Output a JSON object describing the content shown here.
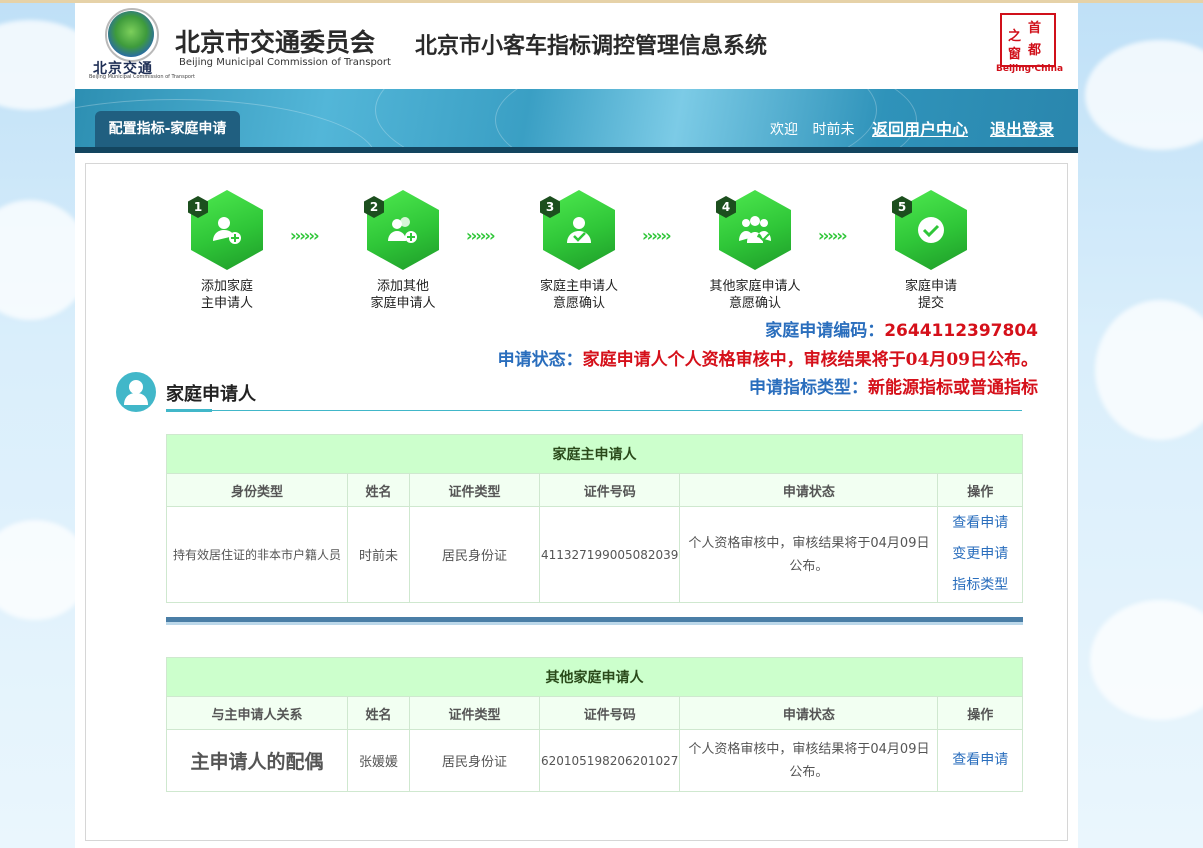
{
  "header": {
    "logo_cn": "北京交通",
    "logo_en": "Beijing Municipal Commission of Transport",
    "org_cn": "北京市交通委员会",
    "org_en": "Beijing Municipal Commission of Transport",
    "system_title": "北京市小客车指标调控管理信息系统",
    "capital_chars": [
      "首",
      "都",
      "之",
      "窗"
    ],
    "capital_en": "Beijing·China"
  },
  "banner": {
    "tab_label": "配置指标-家庭申请",
    "welcome": "欢迎",
    "username": "时前未",
    "back_link": "返回用户中心",
    "logout_link": "退出登录"
  },
  "steps": [
    {
      "num": "1",
      "label1": "添加家庭",
      "label2": "主申请人",
      "icon": "add-user-icon"
    },
    {
      "num": "2",
      "label1": "添加其他",
      "label2": "家庭申请人",
      "icon": "add-group-user-icon"
    },
    {
      "num": "3",
      "label1": "家庭主申请人",
      "label2": "意愿确认",
      "icon": "user-check-icon"
    },
    {
      "num": "4",
      "label1": "其他家庭申请人",
      "label2": "意愿确认",
      "icon": "group-check-icon"
    },
    {
      "num": "5",
      "label1": "家庭申请",
      "label2": "提交",
      "icon": "checkmark-icon"
    }
  ],
  "arrows": "››››››",
  "info": {
    "code_key": "家庭申请编码：",
    "code_val": "2644112397804",
    "status_key": "申请状态：",
    "status_val": "家庭申请人个人资格审核中，审核结果将于04月09日公布。",
    "type_key": "申请指标类型：",
    "type_val": "新能源指标或普通指标"
  },
  "section": {
    "title": "家庭申请人"
  },
  "main_table": {
    "title": "家庭主申请人",
    "headers": [
      "身份类型",
      "姓名",
      "证件类型",
      "证件号码",
      "申请状态",
      "操作"
    ],
    "row": {
      "identity": "持有效居住证的非本市户籍人员",
      "name": "时前未",
      "id_type": "居民身份证",
      "id_number": "411327199005082039",
      "status": "个人资格审核中，审核结果将于04月09日公布。",
      "op1": "查看申请",
      "op2": "变更申请指标类型"
    }
  },
  "other_table": {
    "title": "其他家庭申请人",
    "headers": [
      "与主申请人关系",
      "姓名",
      "证件类型",
      "证件号码",
      "申请状态",
      "操作"
    ],
    "row": {
      "relation": "主申请人的配偶",
      "name": "张媛媛",
      "id_type": "居民身份证",
      "id_number": "620105198206201027",
      "status": "个人资格审核中，审核结果将于04月09日公布。",
      "op1": "查看申请"
    }
  },
  "colors": {
    "accent_green": "#2fc638",
    "link_blue": "#2a6ebd",
    "alert_red": "#d5101a",
    "table_header_green": "#ccffcc",
    "banner_dark": "#205f80"
  }
}
